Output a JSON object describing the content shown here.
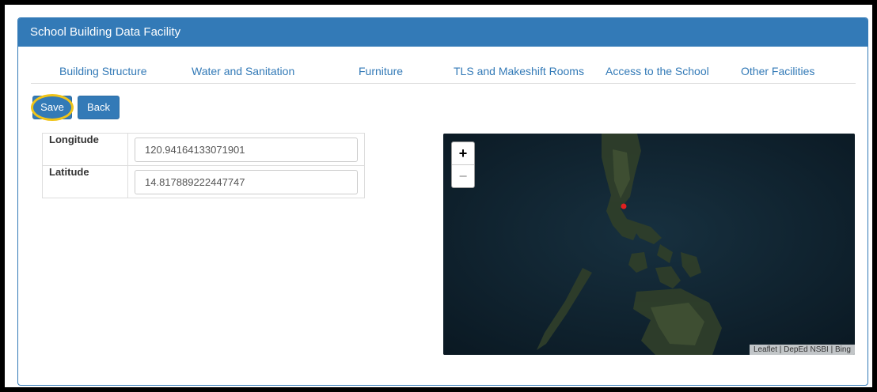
{
  "panel": {
    "title": "School Building Data Facility"
  },
  "tabs": [
    {
      "label": "Building Structure"
    },
    {
      "label": "Water and Sanitation"
    },
    {
      "label": "Furniture"
    },
    {
      "label": "TLS and Makeshift Rooms"
    },
    {
      "label": "Access to the School"
    },
    {
      "label": "Other Facilities"
    }
  ],
  "actions": {
    "save_label": "Save",
    "back_label": "Back"
  },
  "form": {
    "longitude": {
      "label": "Longitude",
      "value": "120.94164133071901"
    },
    "latitude": {
      "label": "Latitude",
      "value": "14.817889222447747"
    }
  },
  "map": {
    "zoom_in": "+",
    "zoom_out": "−",
    "attribution": "Leaflet | DepEd NSBI | Bing"
  },
  "colors": {
    "primary": "#337ab7",
    "highlight_ring": "#f0c419",
    "marker": "#e02020"
  }
}
